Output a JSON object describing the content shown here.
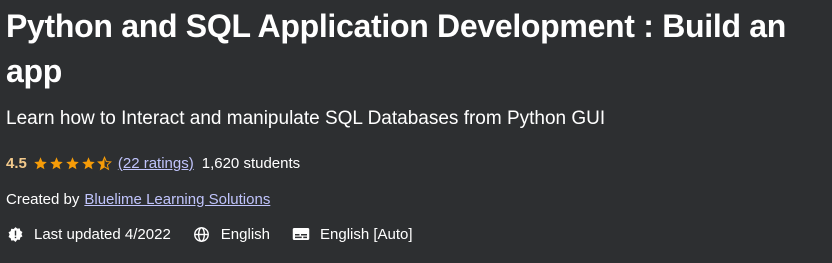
{
  "course": {
    "title": "Python and SQL Application Development : Build an app",
    "subtitle": "Learn how to Interact and manipulate SQL Databases from Python GUI"
  },
  "rating": {
    "value": "4.5",
    "stars_filled": 4.5,
    "stars_total": 5,
    "ratings_link": "(22 ratings)",
    "students": "1,620 students",
    "star_color": "#f69c08"
  },
  "creator": {
    "prefix": "Created by",
    "name": "Bluelime Learning Solutions"
  },
  "meta": {
    "updated": "Last updated 4/2022",
    "language": "English",
    "captions": "English [Auto]"
  },
  "icons": {
    "updated": "alert-badge-icon",
    "language": "globe-icon",
    "captions": "closed-captions-icon"
  },
  "colors": {
    "background": "#2d2f31",
    "link": "#c0c4fc",
    "rating_text": "#f3ca8c"
  }
}
